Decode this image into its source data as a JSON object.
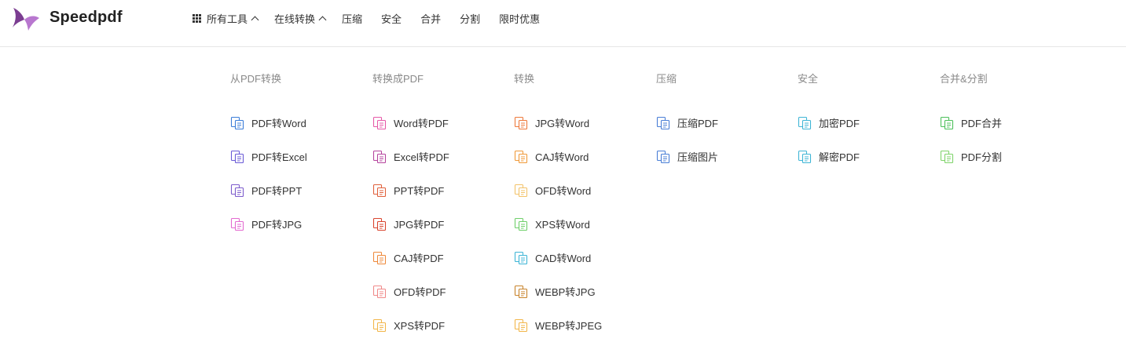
{
  "header": {
    "brand": "Speedpdf",
    "logo_colors": {
      "primary": "#7b3d91",
      "secondary": "#b877cf"
    },
    "nav": [
      {
        "label": "所有工具",
        "has_grid_icon": true,
        "has_caret": true
      },
      {
        "label": "在线转换",
        "has_grid_icon": false,
        "has_caret": true
      },
      {
        "label": "压缩",
        "has_grid_icon": false,
        "has_caret": false
      },
      {
        "label": "安全",
        "has_grid_icon": false,
        "has_caret": false
      },
      {
        "label": "合并",
        "has_grid_icon": false,
        "has_caret": false
      },
      {
        "label": "分割",
        "has_grid_icon": false,
        "has_caret": false
      },
      {
        "label": "限时优惠",
        "has_grid_icon": false,
        "has_caret": false
      }
    ]
  },
  "menu": {
    "columns": [
      {
        "title": "从PDF转换",
        "items": [
          {
            "label": "PDF转Word",
            "icon": "pdf-to-word-icon",
            "color": "#3b7dd8"
          },
          {
            "label": "PDF转Excel",
            "icon": "pdf-to-excel-icon",
            "color": "#6a5bd6"
          },
          {
            "label": "PDF转PPT",
            "icon": "pdf-to-ppt-icon",
            "color": "#7d5ccc"
          },
          {
            "label": "PDF转JPG",
            "icon": "pdf-to-jpg-icon",
            "color": "#e36ad0"
          }
        ]
      },
      {
        "title": "转换成PDF",
        "items": [
          {
            "label": "Word转PDF",
            "icon": "word-to-pdf-icon",
            "color": "#e65aa8"
          },
          {
            "label": "Excel转PDF",
            "icon": "excel-to-pdf-icon",
            "color": "#b5459e"
          },
          {
            "label": "PPT转PDF",
            "icon": "ppt-to-pdf-icon",
            "color": "#e0613c"
          },
          {
            "label": "JPG转PDF",
            "icon": "jpg-to-pdf-icon",
            "color": "#d9452f"
          },
          {
            "label": "CAJ转PDF",
            "icon": "caj-to-pdf-icon",
            "color": "#ee8a3c"
          },
          {
            "label": "OFD转PDF",
            "icon": "ofd-to-pdf-icon",
            "color": "#f08a8a"
          },
          {
            "label": "XPS转PDF",
            "icon": "xps-to-pdf-icon",
            "color": "#f2b64a"
          }
        ]
      },
      {
        "title": "转换",
        "items": [
          {
            "label": "JPG转Word",
            "icon": "jpg-to-word-icon",
            "color": "#ee7a3c"
          },
          {
            "label": "CAJ转Word",
            "icon": "caj-to-word-icon",
            "color": "#f09a3a"
          },
          {
            "label": "OFD转Word",
            "icon": "ofd-to-word-icon",
            "color": "#f3c36a"
          },
          {
            "label": "XPS转Word",
            "icon": "xps-to-word-icon",
            "color": "#6fcf6a"
          },
          {
            "label": "CAD转Word",
            "icon": "cad-to-word-icon",
            "color": "#3fb5d6"
          },
          {
            "label": "WEBP转JPG",
            "icon": "webp-to-jpg-icon",
            "color": "#c8842c"
          },
          {
            "label": "WEBP转JPEG",
            "icon": "webp-to-jpeg-icon",
            "color": "#f2b64a"
          }
        ]
      },
      {
        "title": "压缩",
        "items": [
          {
            "label": "压缩PDF",
            "icon": "compress-pdf-icon",
            "color": "#4a7fd6"
          },
          {
            "label": "压缩图片",
            "icon": "compress-image-icon",
            "color": "#4a7fd6"
          }
        ]
      },
      {
        "title": "安全",
        "items": [
          {
            "label": "加密PDF",
            "icon": "encrypt-pdf-icon",
            "color": "#3fb5d6"
          },
          {
            "label": "解密PDF",
            "icon": "decrypt-pdf-icon",
            "color": "#3fb5d6"
          }
        ]
      },
      {
        "title": "合并&分割",
        "items": [
          {
            "label": "PDF合并",
            "icon": "merge-pdf-icon",
            "color": "#4cc05a"
          },
          {
            "label": "PDF分割",
            "icon": "split-pdf-icon",
            "color": "#7fd36a"
          }
        ]
      }
    ]
  }
}
